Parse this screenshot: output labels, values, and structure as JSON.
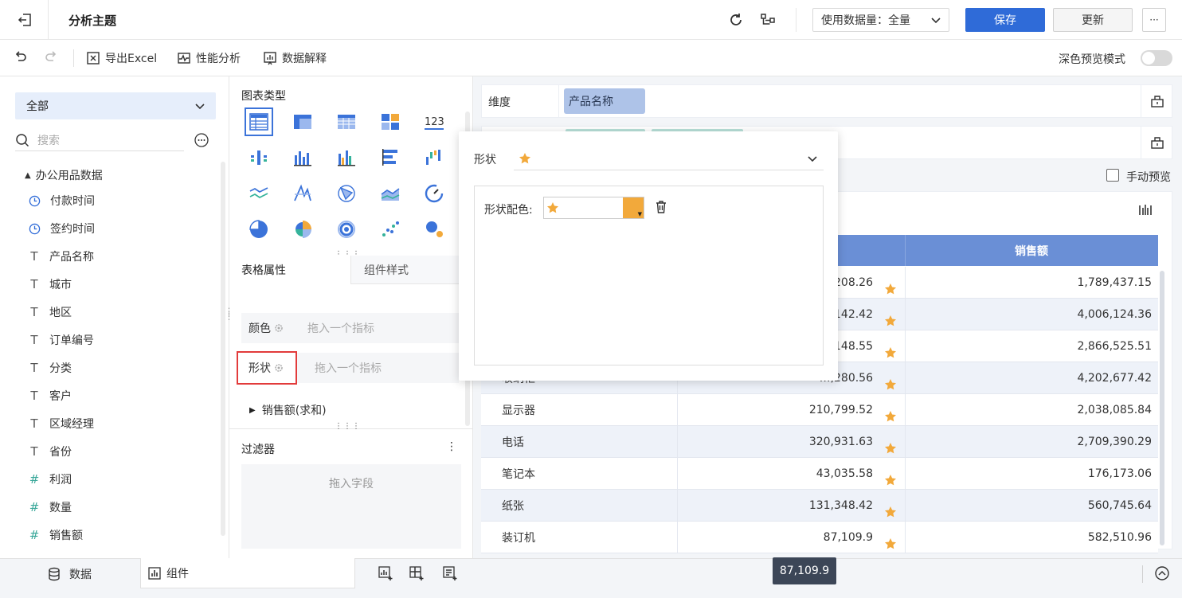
{
  "header": {
    "title": "分析主题",
    "data_amount_label": "使用数据量：全量",
    "save_label": "保存",
    "update_label": "更新",
    "more_label": "···"
  },
  "toolbar": {
    "export_excel": "导出Excel",
    "perf_analysis": "性能分析",
    "data_explain": "数据解释",
    "dark_preview": "深色预览模式"
  },
  "left": {
    "dropdown": "全部",
    "search_placeholder": "搜索",
    "group": "办公用品数据",
    "fields": [
      {
        "type": "time",
        "label": "付款时间"
      },
      {
        "type": "time",
        "label": "签约时间"
      },
      {
        "type": "text",
        "label": "产品名称"
      },
      {
        "type": "text",
        "label": "城市"
      },
      {
        "type": "text",
        "label": "地区"
      },
      {
        "type": "text",
        "label": "订单编号"
      },
      {
        "type": "text",
        "label": "分类"
      },
      {
        "type": "text",
        "label": "客户"
      },
      {
        "type": "text",
        "label": "区域经理"
      },
      {
        "type": "text",
        "label": "省份"
      },
      {
        "type": "num",
        "label": "利润"
      },
      {
        "type": "num",
        "label": "数量"
      },
      {
        "type": "num",
        "label": "销售额"
      }
    ]
  },
  "mid": {
    "chart_type_title": "图表类型",
    "tab_table_props": "表格属性",
    "tab_component_style": "组件样式",
    "color_label": "颜色",
    "color_placeholder": "拖入一个指标",
    "shape_label": "形状",
    "shape_placeholder": "拖入一个指标",
    "measure_label": "销售额(求和)",
    "filter_title": "过滤器",
    "filter_placeholder": "拖入字段",
    "chart_icon_123": "123"
  },
  "right": {
    "dimension_label": "维度",
    "dimension_chip": "产品名称",
    "manual_preview": "手动预览",
    "col_sales": "销售额",
    "rows": [
      {
        "name": "",
        "v1": ",208.26",
        "v2": "1,789,437.15"
      },
      {
        "name": "",
        "v1": ",142.42",
        "v2": "4,006,124.36"
      },
      {
        "name": "",
        "v1": ",148.55",
        "v2": "2,866,525.51"
      },
      {
        "name": "收纳柜",
        "v1": "…,280.56",
        "v2": "4,202,677.42"
      },
      {
        "name": "显示器",
        "v1": "210,799.52",
        "v2": "2,038,085.84"
      },
      {
        "name": "电话",
        "v1": "320,931.63",
        "v2": "2,709,390.29"
      },
      {
        "name": "笔记本",
        "v1": "43,035.58",
        "v2": "176,173.06"
      },
      {
        "name": "纸张",
        "v1": "131,348.42",
        "v2": "560,745.64"
      },
      {
        "name": "装订机",
        "v1": "87,109.9",
        "v2": "582,510.96"
      }
    ]
  },
  "popup": {
    "shape_label": "形状",
    "shape_color_label": "形状配色:"
  },
  "footer": {
    "tab_data": "数据",
    "tab_component": "组件",
    "tooltip": "87,109.9"
  },
  "colors": {
    "primary": "#2f6bd8",
    "chip_blue": "#aec3e8",
    "header_blue": "#6a8fd6",
    "star": "#f2a93b",
    "highlight": "#e23b3b"
  }
}
